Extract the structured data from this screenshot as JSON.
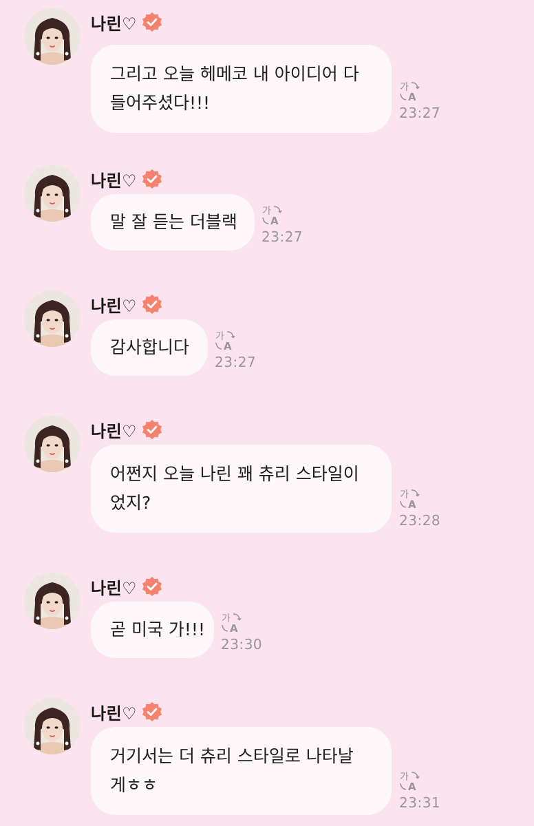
{
  "user": {
    "name": "나린♡",
    "verified_icon": "verified-badge-icon",
    "avatar": "profile-avatar",
    "accent_color": "#f4826f"
  },
  "translate_icon": "translate-icon",
  "messages": [
    {
      "lines": [
        "그리고 오늘 헤메코 내 아이디어 다",
        "들어주셨다!!!"
      ],
      "time": "23:27"
    },
    {
      "lines": [
        "말 잘 듣는 더블랙"
      ],
      "time": "23:27"
    },
    {
      "lines": [
        "감사합니다"
      ],
      "time": "23:27"
    },
    {
      "lines": [
        "어쩐지 오늘 나린 꽤 츄리 스타일이",
        "었지?"
      ],
      "time": "23:28"
    },
    {
      "lines": [
        "곧 미국 가!!!"
      ],
      "time": "23:30"
    },
    {
      "lines": [
        "거기서는 더 츄리 스타일로 나타날",
        "게ㅎㅎ"
      ],
      "time": "23:31"
    }
  ]
}
